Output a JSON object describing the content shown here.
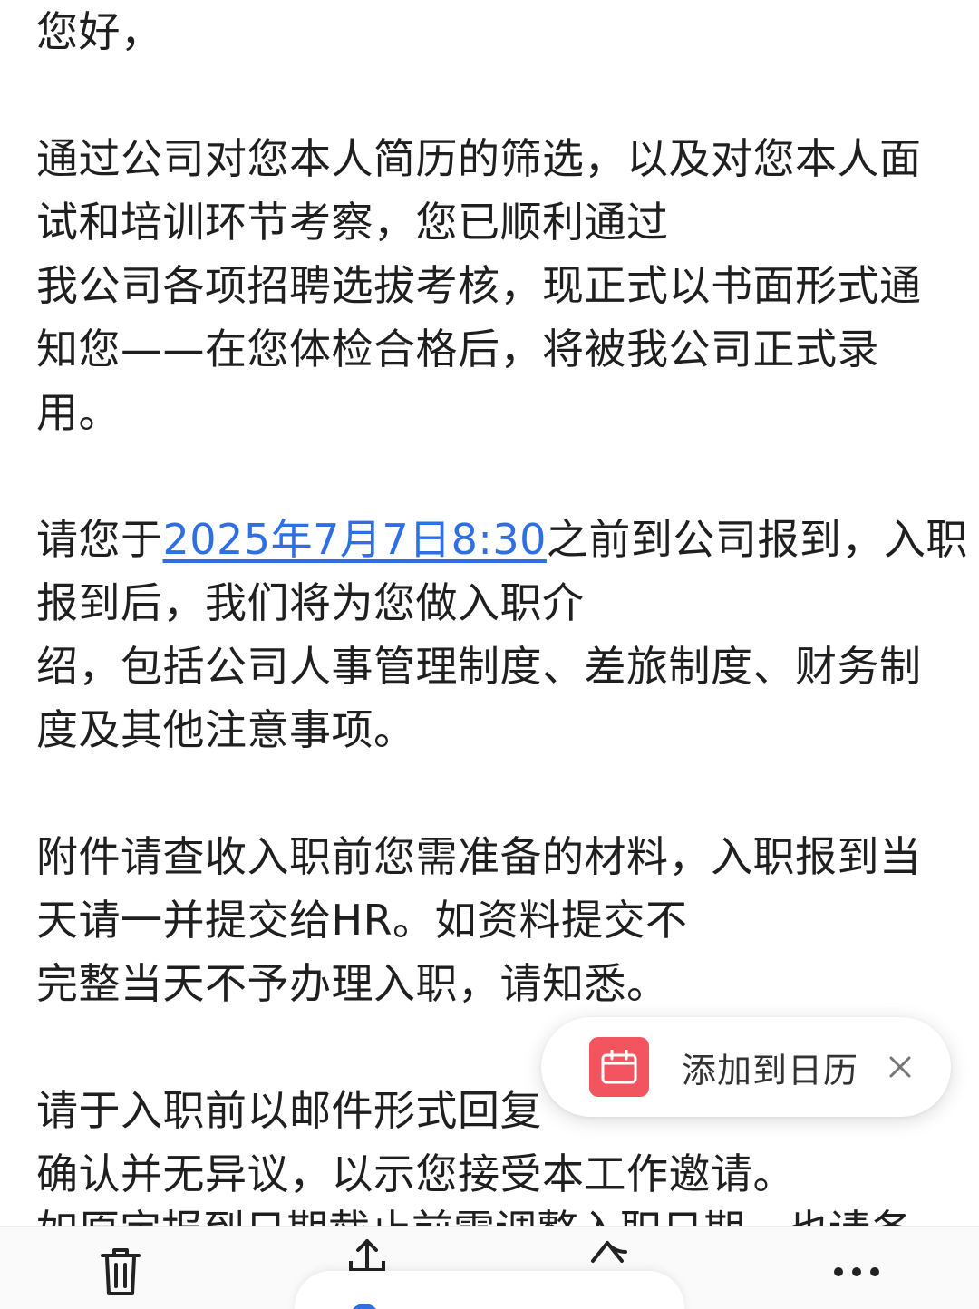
{
  "email": {
    "greeting": "您好，",
    "para1": [
      "通过公司对您本人简历的筛选，以及对您本人面",
      "试和培训环节考察，您已顺利通过",
      "我公司各项招聘选拔考核，现正式以书面形式通",
      "知您——在您体检合格后，将被我公司正式录",
      "用。"
    ],
    "para2": {
      "prefix": "请您于",
      "date_link": "2025年7月7日8:30",
      "suffix": "之前到公司报到，入职",
      "lines": [
        "报到后，我们将为您做入职介",
        "绍，包括公司人事管理制度、差旅制度、财务制",
        "度及其他注意事项。"
      ]
    },
    "para3": [
      "附件请查收入职前您需准备的材料，入职报到当",
      "天请一并提交给HR。如资料提交不",
      "完整当天不予办理入职，请知悉。"
    ],
    "para4": [
      "请于入职前以邮件形式回复",
      "确认并无异议，以示您接受本工作邀请。"
    ],
    "clipped_line": "如原定报到日期截止前需调整入职日期，也请务"
  },
  "calendar_popup": {
    "label": "添加到日历",
    "icon": "calendar-icon",
    "close_icon": "close-icon",
    "accent_color": "#f2555f"
  },
  "toolbar": {
    "items": [
      {
        "icon": "trash-icon"
      },
      {
        "icon": "forward-icon"
      },
      {
        "icon": "reply-icon"
      },
      {
        "icon": "more-icon"
      }
    ]
  },
  "colors": {
    "link": "#2f6fe4",
    "text": "#1f1f1f"
  }
}
